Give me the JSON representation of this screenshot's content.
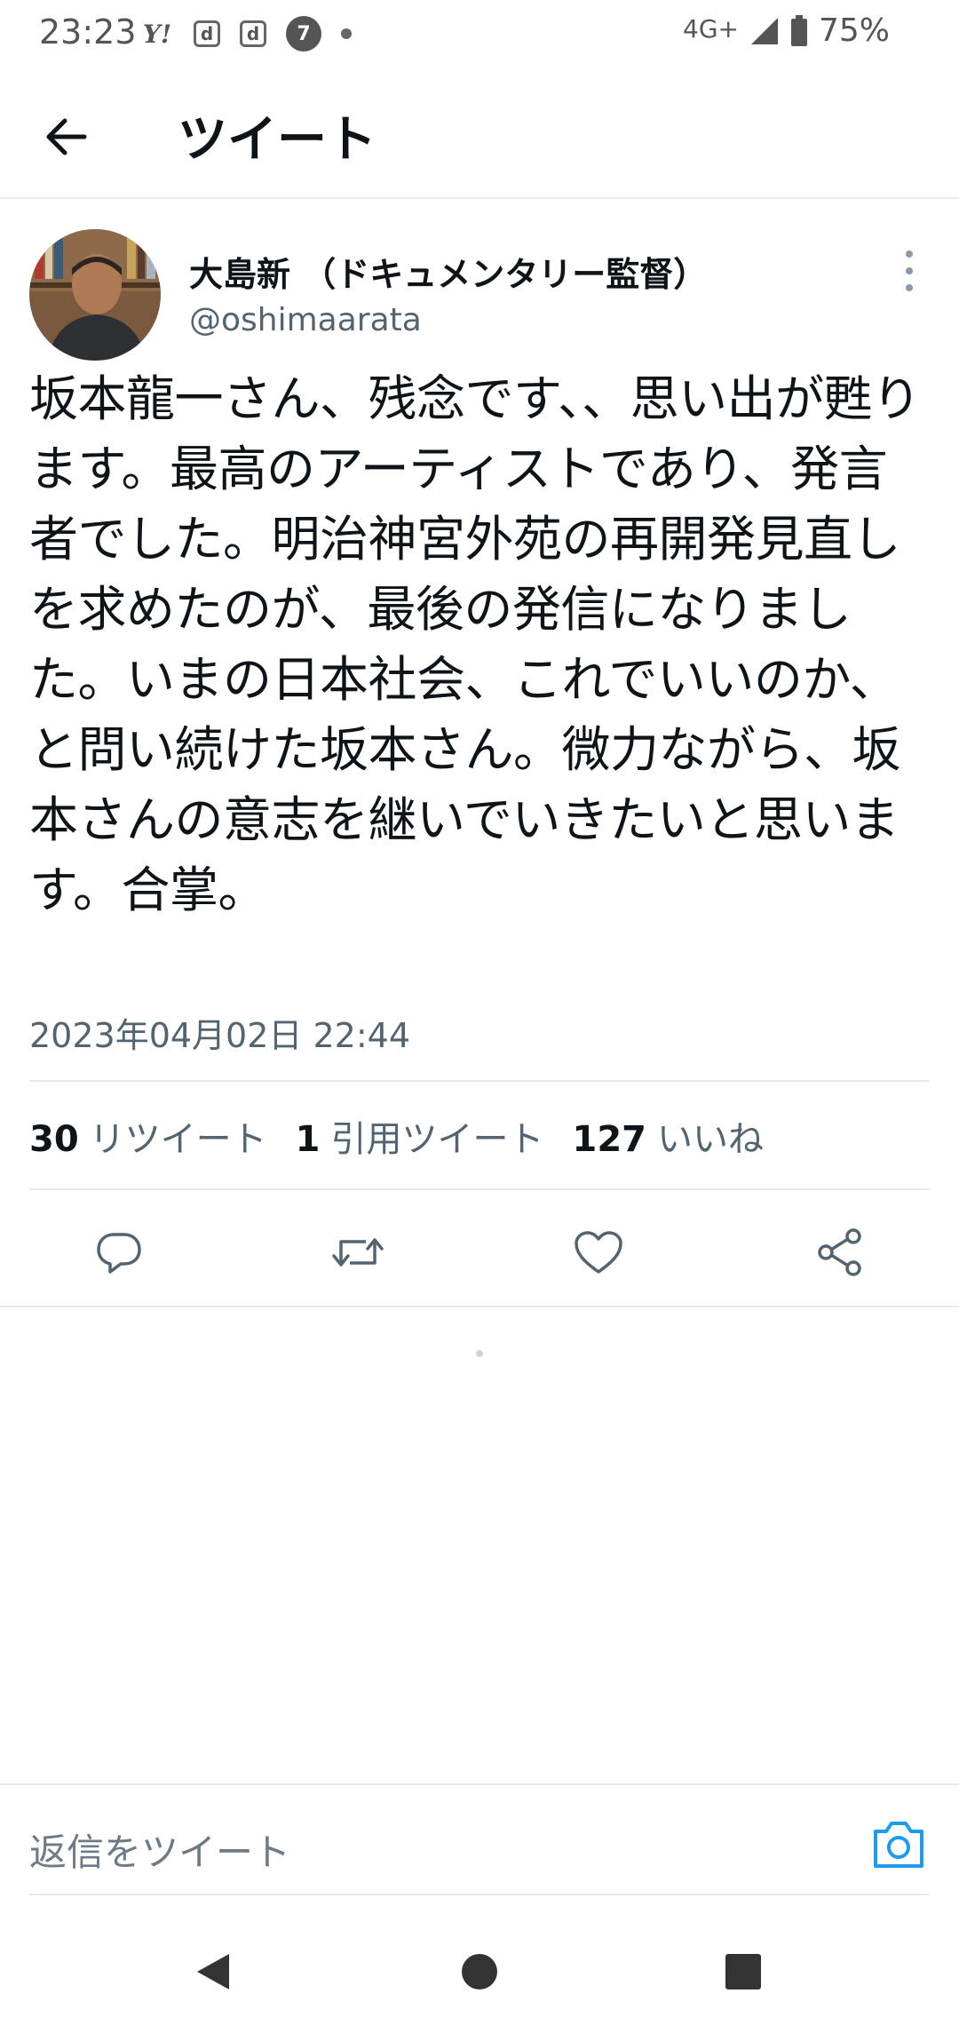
{
  "status_bar": {
    "time": "23:23",
    "network": "4G+",
    "battery": "75%",
    "notification_icons": [
      "yahoo-icon",
      "d-app-icon",
      "d-app-icon",
      "seven-eleven-icon",
      "dot-icon"
    ]
  },
  "header": {
    "title": "ツイート"
  },
  "tweet": {
    "display_name": "大島新 （ドキュメンタリー監督）",
    "handle": "@oshimaarata",
    "text": "坂本龍一さん、残念です、、思い出が甦ります。最高のアーティストであり、発言者でした。明治神宮外苑の再開発見直しを求めたのが、最後の発信になりました。いまの日本社会、これでいいのか、と問い続けた坂本さん。微力ながら、坂本さんの意志を継いでいきたいと思います。合掌。",
    "timestamp": "2023年04月02日 22:44",
    "stats": {
      "retweets": {
        "count": "30",
        "label": "リツイート"
      },
      "quotes": {
        "count": "1",
        "label": "引用ツイート"
      },
      "likes": {
        "count": "127",
        "label": "いいね"
      }
    }
  },
  "reply": {
    "placeholder": "返信をツイート"
  },
  "colors": {
    "text_primary": "#0f1419",
    "text_secondary": "#536471",
    "accent": "#1d9bf0",
    "divider": "#e7e9ea"
  }
}
